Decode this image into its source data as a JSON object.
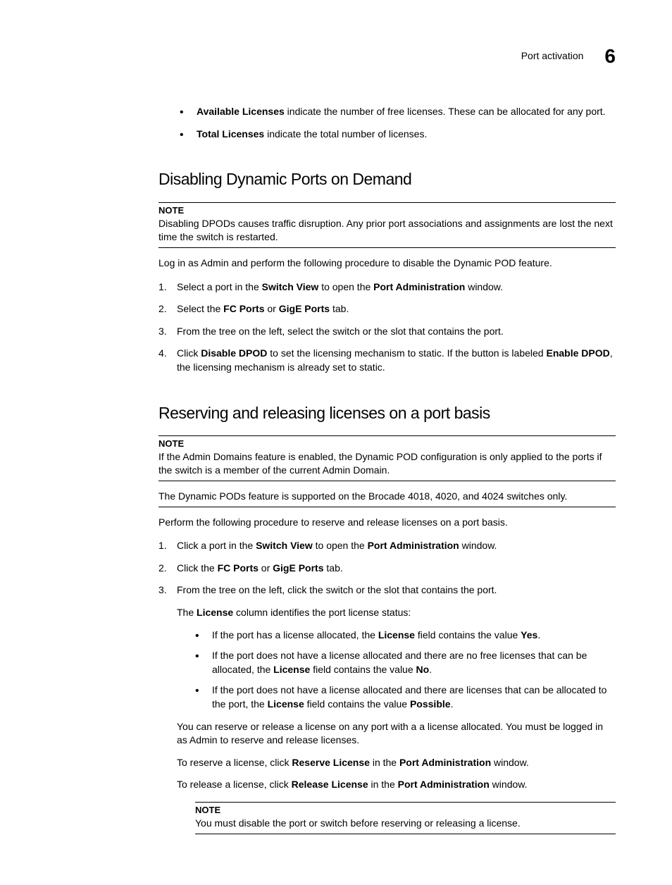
{
  "header": {
    "topic": "Port activation",
    "chapter": "6"
  },
  "intro_bullets": [
    {
      "lead": "Available Licenses",
      "rest": " indicate the number of free licenses. These can be allocated for any port."
    },
    {
      "lead": "Total Licenses",
      "rest": " indicate the total number of licenses."
    }
  ],
  "section1": {
    "title": "Disabling Dynamic Ports on Demand",
    "note_label": "NOTE",
    "note_body": "Disabling DPODs causes traffic disruption. Any prior port associations and assignments are lost the next time the switch is restarted.",
    "intro": "Log in as Admin and perform the following procedure to disable the Dynamic POD feature.",
    "steps": {
      "s1": {
        "seg0": "Select a port in the ",
        "seg1": "Switch View",
        "seg2": " to open the ",
        "seg3": "Port Administration",
        "seg4": " window."
      },
      "s2": {
        "seg0": "Select the ",
        "seg1": "FC Ports",
        "seg2": " or ",
        "seg3": "GigE Ports",
        "seg4": " tab."
      },
      "s3": "From the tree on the left, select the switch or the slot that contains the port.",
      "s4": {
        "seg0": "Click ",
        "seg1": "Disable DPOD",
        "seg2": " to set the licensing mechanism to static. If the button is labeled ",
        "seg3": "Enable DPOD",
        "seg4": ", the licensing mechanism is already set to static."
      }
    }
  },
  "section2": {
    "title": "Reserving and releasing licenses on a port basis",
    "note_label": "NOTE",
    "note_body": "If the Admin Domains feature is enabled, the Dynamic POD configuration is only applied to the ports if the switch is a member of the current Admin Domain.",
    "support_line": "The Dynamic PODs feature is supported on the Brocade 4018, 4020, and 4024 switches only.",
    "intro": "Perform the following procedure to reserve and release licenses on a port basis.",
    "steps": {
      "s1": {
        "seg0": "Click a port in the ",
        "seg1": "Switch View",
        "seg2": " to open the ",
        "seg3": "Port Administration",
        "seg4": " window."
      },
      "s2": {
        "seg0": "Click the ",
        "seg1": "FC Ports",
        "seg2": " or ",
        "seg3": "GigE Ports",
        "seg4": " tab."
      },
      "s3": {
        "main": "From the tree on the left, click the switch or the slot that contains the port.",
        "desc": {
          "seg0": "The ",
          "seg1": "License",
          "seg2": " column identifies the port license status:"
        },
        "bullets": {
          "b1": {
            "seg0": "If the port has a license allocated, the ",
            "seg1": "License",
            "seg2": " field contains the value ",
            "seg3": "Yes",
            "seg4": "."
          },
          "b2": {
            "seg0": "If the port does not have a license allocated and there are no free licenses that can be allocated, the ",
            "seg1": "License",
            "seg2": " field contains the value ",
            "seg3": "No",
            "seg4": "."
          },
          "b3": {
            "seg0": "If the port does not have a license allocated and there are licenses that can be allocated to the port, the ",
            "seg1": "License",
            "seg2": " field contains the value ",
            "seg3": "Possible",
            "seg4": "."
          }
        },
        "after": "You can reserve or release a license on any port with a a license allocated. You must be logged in as Admin to reserve and release licenses.",
        "reserve": {
          "seg0": "To reserve a license, click ",
          "seg1": "Reserve License",
          "seg2": " in the ",
          "seg3": "Port Administration",
          "seg4": " window."
        },
        "release": {
          "seg0": "To release a license, click ",
          "seg1": "Release License",
          "seg2": " in the ",
          "seg3": "Port Administration",
          "seg4": " window."
        },
        "final_note_label": "NOTE",
        "final_note_body": "You must disable the port or switch before reserving or releasing a license."
      }
    }
  }
}
